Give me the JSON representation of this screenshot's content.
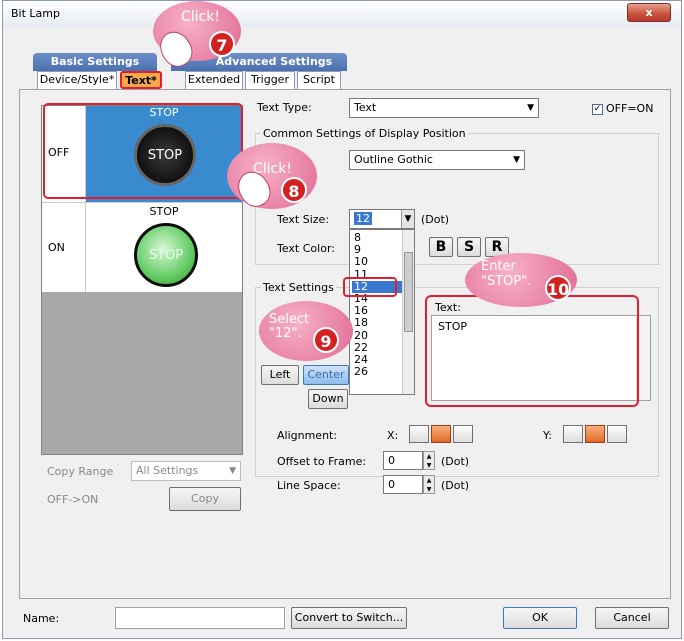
{
  "window": {
    "title": "Bit Lamp",
    "close": "x"
  },
  "groups": {
    "basic": "Basic Settings",
    "advanced": "Advanced Settings"
  },
  "tabs": [
    "Device/Style*",
    "Text*",
    "Extended",
    "Trigger",
    "Script"
  ],
  "preview": {
    "off_label": "OFF",
    "on_label": "ON",
    "off_caption": "STOP",
    "on_caption": "STOP",
    "off_lamp_text": "STOP",
    "on_lamp_text": "STOP"
  },
  "text_type": {
    "label": "Text Type:",
    "value": "Text"
  },
  "off_on": {
    "label": "OFF=ON",
    "checked": true
  },
  "common": {
    "heading": "Common Settings of Display Position",
    "font_value": "Outline Gothic"
  },
  "text_size": {
    "label": "Text Size:",
    "value": "12",
    "unit": "(Dot)"
  },
  "size_list": [
    "8",
    "9",
    "10",
    "11",
    "12",
    "14",
    "16",
    "18",
    "20",
    "22",
    "24",
    "26"
  ],
  "size_selected": "12",
  "text_color": {
    "label": "Text Color:",
    "bold": "B",
    "shadow": "S",
    "raised": "R"
  },
  "text_settings": {
    "heading": "Text Settings",
    "left": "Left",
    "center": "Center",
    "down": "Down"
  },
  "text_field": {
    "label": "Text:",
    "value": "STOP"
  },
  "alignment": {
    "label": "Alignment:",
    "x": "X:",
    "y": "Y:"
  },
  "offset": {
    "label": "Offset to Frame:",
    "value": "0",
    "unit": "(Dot)"
  },
  "line_space": {
    "label": "Line Space:",
    "value": "0",
    "unit": "(Dot)"
  },
  "copy": {
    "range_label": "Copy Range",
    "range_value": "All Settings",
    "dir_label": "OFF->ON",
    "button": "Copy"
  },
  "footer": {
    "name_label": "Name:",
    "name_value": "",
    "convert": "Convert to Switch...",
    "ok": "OK",
    "cancel": "Cancel"
  },
  "callouts": {
    "c7": {
      "text": "Click!",
      "num": "7"
    },
    "c8": {
      "text": "Click!",
      "num": "8"
    },
    "c9": {
      "text": "Select \"12\".",
      "num": "9"
    },
    "c10": {
      "text": "Enter \"STOP\".",
      "num": "10"
    }
  },
  "colors": {
    "highlight": "#e02030",
    "tab_active": "#f7a84a",
    "lamp_off": "#1a1a1a",
    "lamp_on": "#7ed87e",
    "group_tab": "#5a7fbe"
  }
}
